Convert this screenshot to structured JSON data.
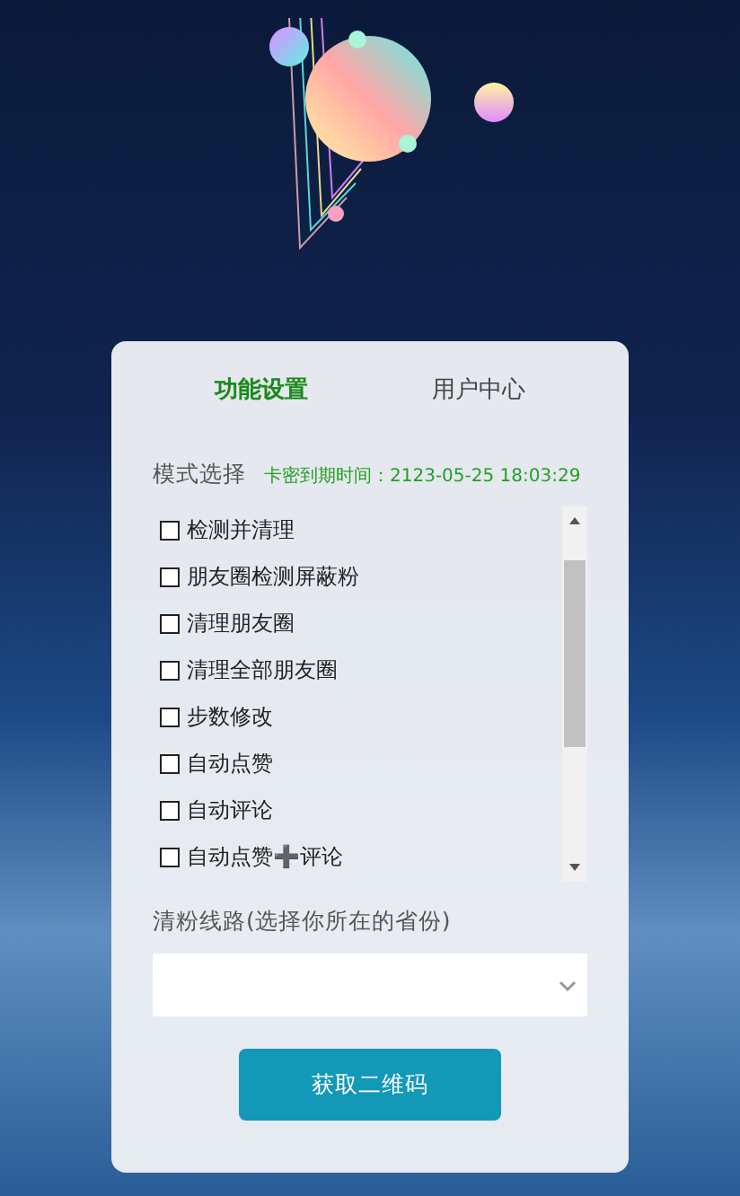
{
  "tabs": [
    {
      "label": "功能设置",
      "selected": true
    },
    {
      "label": "用户中心",
      "selected": false
    }
  ],
  "mode": {
    "label": "模式选择",
    "expiry": "卡密到期时间：2123-05-25 18:03:29"
  },
  "options": [
    {
      "label": "检测并清理",
      "checked": false
    },
    {
      "label": "朋友圈检测屏蔽粉",
      "checked": false
    },
    {
      "label": "清理朋友圈",
      "checked": false
    },
    {
      "label": "清理全部朋友圈",
      "checked": false
    },
    {
      "label": "步数修改",
      "checked": false
    },
    {
      "label": "自动点赞",
      "checked": false
    },
    {
      "label": "自动评论",
      "checked": false
    },
    {
      "label": "自动点赞➕评论",
      "checked": false
    }
  ],
  "route": {
    "label": "清粉线路(选择你所在的省份)"
  },
  "button": "获取二维码"
}
